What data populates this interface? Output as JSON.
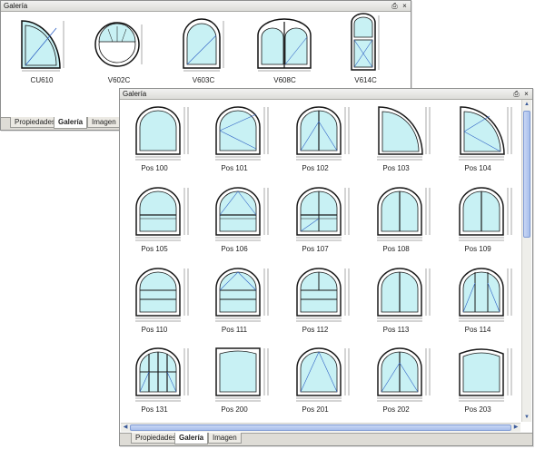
{
  "top_panel": {
    "title": "Galería",
    "pin_icon": "pin-icon",
    "close_icon": "close-icon",
    "items": [
      {
        "label": "CU610"
      },
      {
        "label": "V602C"
      },
      {
        "label": "V603C"
      },
      {
        "label": "V608C"
      },
      {
        "label": "V614C"
      }
    ],
    "tabs": [
      "Propiedades",
      "Galería",
      "Imagen"
    ],
    "active_tab": "Galería"
  },
  "main_panel": {
    "title": "Galería",
    "pin_icon": "pin-icon",
    "close_icon": "close-icon",
    "items": [
      {
        "label": "Pos 100"
      },
      {
        "label": "Pos 101"
      },
      {
        "label": "Pos 102"
      },
      {
        "label": "Pos 103"
      },
      {
        "label": "Pos 104"
      },
      {
        "label": "Pos 105"
      },
      {
        "label": "Pos 106"
      },
      {
        "label": "Pos 107"
      },
      {
        "label": "Pos 108"
      },
      {
        "label": "Pos 109"
      },
      {
        "label": "Pos 110"
      },
      {
        "label": "Pos 111"
      },
      {
        "label": "Pos 112"
      },
      {
        "label": "Pos 113"
      },
      {
        "label": "Pos 114"
      },
      {
        "label": "Pos 131"
      },
      {
        "label": "Pos 200"
      },
      {
        "label": "Pos 201"
      },
      {
        "label": "Pos 202"
      },
      {
        "label": "Pos 203"
      }
    ],
    "tabs": [
      "Propiedades",
      "Galería",
      "Imagen"
    ],
    "active_tab": "Galería"
  },
  "colors": {
    "glass": "#c8f1f4",
    "frame": "#1a1a1a",
    "dim": "#555555",
    "accent": "#3163c5"
  }
}
